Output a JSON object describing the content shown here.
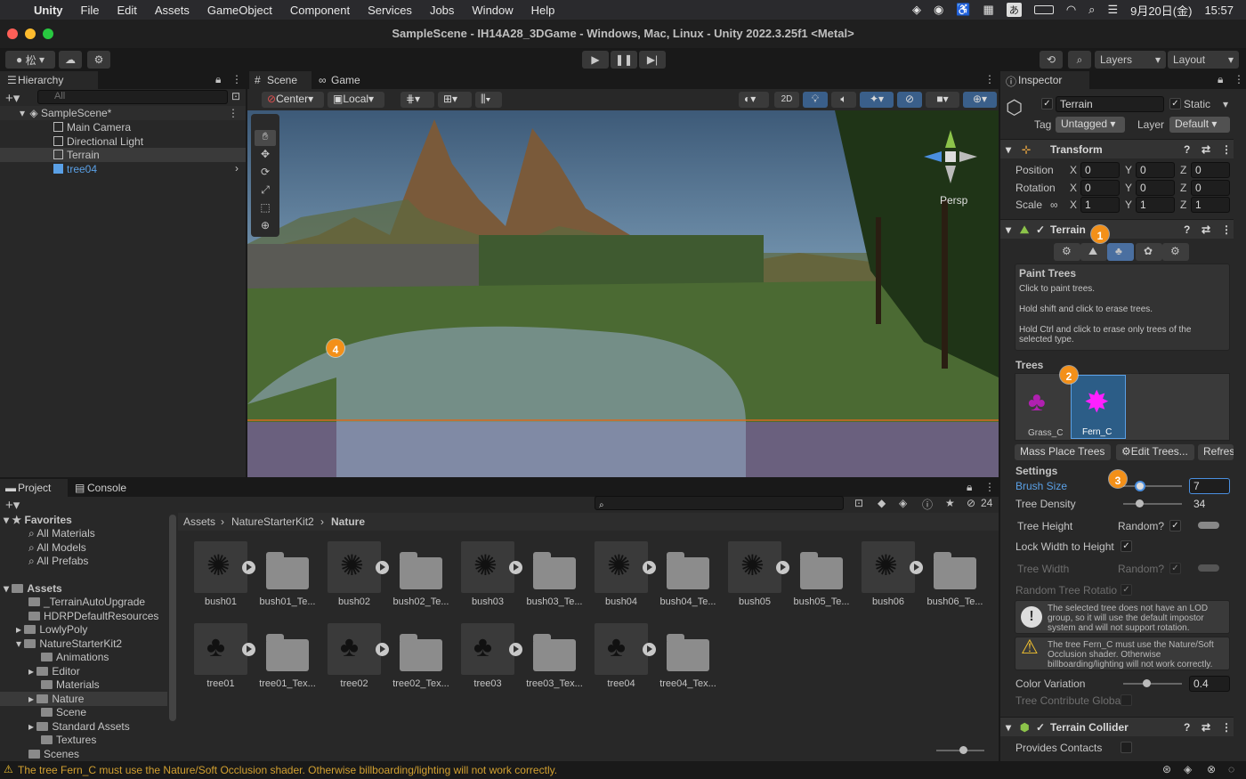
{
  "menubar": {
    "app": "Unity",
    "items": [
      "File",
      "Edit",
      "Assets",
      "GameObject",
      "Component",
      "Services",
      "Jobs",
      "Window",
      "Help"
    ],
    "ime": "あ",
    "date": "9月20日(金)",
    "time": "15:57"
  },
  "window": {
    "title": "SampleScene - IH14A28_3DGame - Windows, Mac, Linux - Unity 2022.3.25f1 <Metal>"
  },
  "toolbar": {
    "account": "松",
    "layers": "Layers",
    "layout": "Layout"
  },
  "hierarchy": {
    "tab": "Hierarchy",
    "search_placeholder": "All",
    "scene": "SampleScene*",
    "items": [
      "Main Camera",
      "Directional Light",
      "Terrain",
      "tree04"
    ]
  },
  "scene": {
    "tab_scene": "Scene",
    "tab_game": "Game",
    "pivot": "Center",
    "space": "Local",
    "mode2d": "2D",
    "persp": "Persp"
  },
  "inspector": {
    "tab": "Inspector",
    "object_name": "Terrain",
    "static": "Static",
    "tag_label": "Tag",
    "tag": "Untagged",
    "layer_label": "Layer",
    "layer": "Default",
    "transform": {
      "title": "Transform",
      "position_label": "Position",
      "rotation_label": "Rotation",
      "scale_label": "Scale",
      "x": "X",
      "y": "Y",
      "z": "Z",
      "position": [
        "0",
        "0",
        "0"
      ],
      "rotation": [
        "0",
        "0",
        "0"
      ],
      "scale": [
        "1",
        "1",
        "1"
      ]
    },
    "terrain": {
      "title": "Terrain",
      "paint_title": "Paint Trees",
      "help1": "Click to paint trees.",
      "help2": "Hold shift and click to erase trees.",
      "help3": "Hold Ctrl and click to erase only trees of the selected type.",
      "trees_label": "Trees",
      "tree1": "Grass_C",
      "tree2": "Fern_C",
      "mass_place": "Mass Place Trees",
      "edit_trees": "Edit Trees...",
      "refresh": "Refres",
      "settings": "Settings",
      "brush_size_label": "Brush Size",
      "brush_size": "7",
      "tree_density_label": "Tree Density",
      "tree_density": "34",
      "tree_height_label": "Tree Height",
      "random_label": "Random?",
      "lock_label": "Lock Width to Height",
      "tree_width_label": "Tree Width",
      "random_rot_label": "Random Tree Rotatio",
      "warn1": "The selected tree does not have an LOD group, so it will use the default impostor system and will not support rotation.",
      "warn2": "The tree Fern_C must use the Nature/Soft Occlusion shader. Otherwise billboarding/lighting will not work correctly.",
      "color_var_label": "Color Variation",
      "color_var": "0.4",
      "contrib_label": "Tree Contribute Globa"
    },
    "collider": {
      "title": "Terrain Collider",
      "provides": "Provides Contacts"
    }
  },
  "project": {
    "tab_project": "Project",
    "tab_console": "Console",
    "count": "24",
    "favorites": "Favorites",
    "fav_items": [
      "All Materials",
      "All Models",
      "All Prefabs"
    ],
    "assets": "Assets",
    "asset_items": [
      "_TerrainAutoUpgrade",
      "HDRPDefaultResources",
      "LowlyPoly",
      "NatureStarterKit2",
      "Animations",
      "Editor",
      "Materials",
      "Nature",
      "Scene",
      "Standard Assets",
      "Textures",
      "Scenes"
    ],
    "breadcrumb": [
      "Assets",
      "NatureStarterKit2",
      "Nature"
    ],
    "grid": [
      "bush01",
      "bush01_Te...",
      "bush02",
      "bush02_Te...",
      "bush03",
      "bush03_Te...",
      "bush04",
      "bush04_Te...",
      "bush05",
      "bush05_Te...",
      "bush06",
      "bush06_Te...",
      "tree01",
      "tree01_Tex...",
      "tree02",
      "tree02_Tex...",
      "tree03",
      "tree03_Tex...",
      "tree04",
      "tree04_Tex..."
    ]
  },
  "status": {
    "message": "The tree Fern_C must use the Nature/Soft Occlusion shader. Otherwise billboarding/lighting will not work correctly."
  },
  "badges": [
    "1",
    "2",
    "3",
    "4"
  ],
  "colors": {
    "accent": "#f39019",
    "link": "#4a9fe8",
    "selection": "#2c5d87"
  }
}
